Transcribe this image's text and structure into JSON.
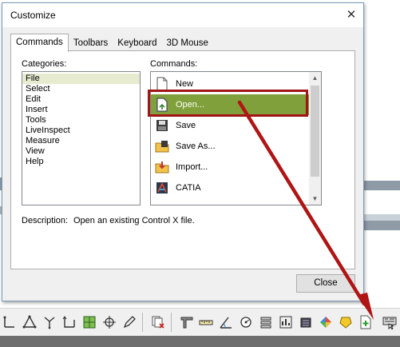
{
  "dialog": {
    "title": "Customize",
    "close_glyph": "✕",
    "tabs": [
      {
        "label": "Commands"
      },
      {
        "label": "Toolbars"
      },
      {
        "label": "Keyboard"
      },
      {
        "label": "3D Mouse"
      }
    ],
    "categories_label": "Categories:",
    "commands_label": "Commands:",
    "categories": [
      "File",
      "Select",
      "Edit",
      "Insert",
      "Tools",
      "LiveInspect",
      "Measure",
      "View",
      "Help"
    ],
    "selected_category": "File",
    "commands": [
      {
        "label": "New",
        "icon": "new-document-icon"
      },
      {
        "label": "Open...",
        "icon": "open-file-icon"
      },
      {
        "label": "Save",
        "icon": "save-disk-icon"
      },
      {
        "label": "Save As...",
        "icon": "save-as-icon"
      },
      {
        "label": "Import...",
        "icon": "import-icon"
      },
      {
        "label": "CATIA",
        "icon": "catia-icon"
      }
    ],
    "selected_command": "Open...",
    "description_label": "Description:",
    "description_text": "Open an existing Control X file.",
    "close_button": "Close"
  },
  "colors": {
    "selected_command_bg": "#7fa03a",
    "highlight_box": "#a01515",
    "arrow": "#b01515",
    "selected_category_bg": "#e7ecd0"
  },
  "toolbar": {
    "icons": [
      "measure-icon",
      "triangle-icon",
      "fork-icon",
      "corner-icon",
      "grid-icon",
      "crosshair-icon",
      "pen-icon",
      "delete-copy-icon",
      "caliper-icon",
      "ruler-icon",
      "angle-icon",
      "circle-gauge-icon",
      "stack-icon",
      "scale-icon",
      "layer-icon",
      "color-map-icon",
      "shape-icon",
      "add-document-icon",
      "customize-toolbar-icon"
    ]
  }
}
